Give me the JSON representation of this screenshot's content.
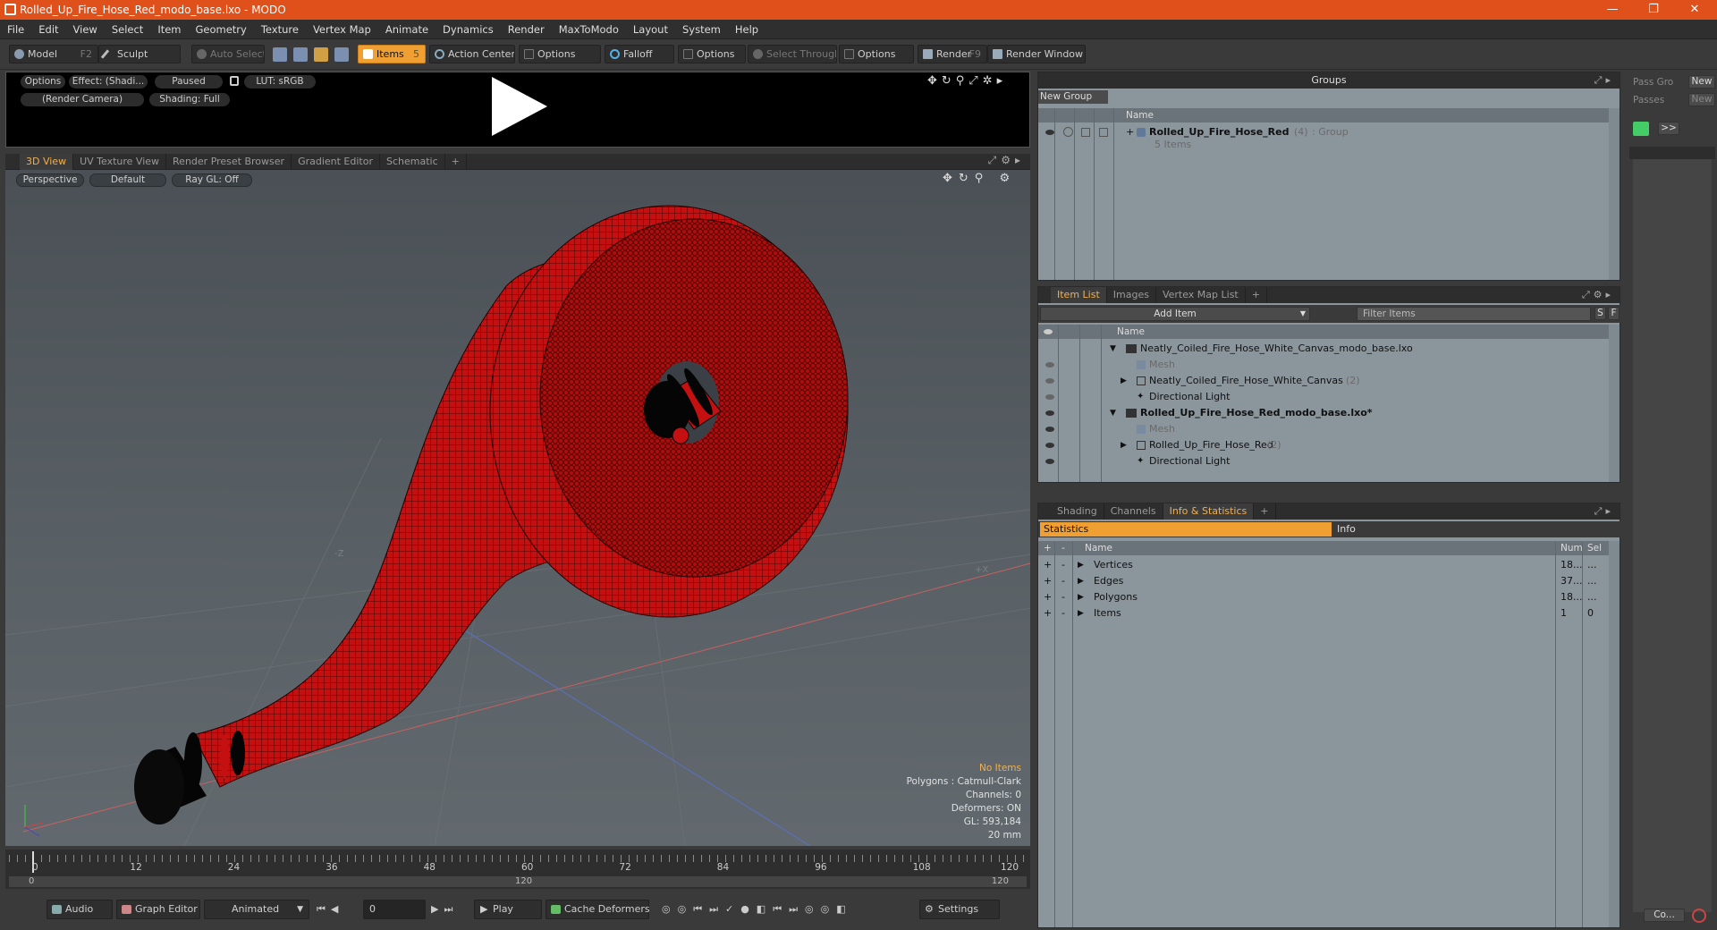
{
  "window": {
    "title": "Rolled_Up_Fire_Hose_Red_modo_base.lxo - MODO",
    "minimize": "—",
    "maximize": "❐",
    "close": "✕"
  },
  "menu": [
    "File",
    "Edit",
    "View",
    "Select",
    "Item",
    "Geometry",
    "Texture",
    "Vertex Map",
    "Animate",
    "Dynamics",
    "Render",
    "MaxToModo",
    "Layout",
    "System",
    "Help"
  ],
  "toolbar": {
    "model": "Model",
    "model_key": "F2",
    "sculpt": "Sculpt",
    "auto_select": "Auto Select",
    "items": "Items",
    "items_key": "5",
    "action_center": "Action Center",
    "options1": "Options",
    "falloff": "Falloff",
    "options2": "Options",
    "select_through": "Select Through",
    "options3": "Options",
    "render": "Render",
    "render_key": "F9",
    "render_window": "Render Window"
  },
  "preview": {
    "options": "Options",
    "effect": "Effect: (Shadi...",
    "paused": "Paused",
    "lut": "LUT: sRGB",
    "camera": "(Render Camera)",
    "shading": "Shading: Full"
  },
  "view_tabs": [
    "3D View",
    "UV Texture View",
    "Render Preset Browser",
    "Gradient Editor",
    "Schematic",
    "+"
  ],
  "viewport": {
    "perspective": "Perspective",
    "default": "Default",
    "raygl": "Ray GL: Off",
    "axis_z": "-Z",
    "axis_x": "+X",
    "hud": {
      "no_items": "No Items",
      "polygons": "Polygons : Catmull-Clark",
      "channels": "Channels: 0",
      "deformers": "Deformers: ON",
      "gl": "GL: 593,184",
      "scale": "20 mm"
    }
  },
  "timeline": {
    "ticks": [
      "0",
      "12",
      "24",
      "36",
      "48",
      "60",
      "72",
      "84",
      "96",
      "108",
      "120"
    ],
    "range_start": "0",
    "range_mid": "120",
    "range_end": "120"
  },
  "bottom": {
    "audio": "Audio",
    "graph_editor": "Graph Editor",
    "animated": "Animated",
    "frame": "0",
    "play": "Play",
    "cache": "Cache Deformers",
    "settings": "Settings"
  },
  "groups": {
    "title": "Groups",
    "new_group": "New Group",
    "col_name": "Name",
    "item_name": "Rolled_Up_Fire_Hose_Red",
    "item_count": "(4)",
    "item_type": ": Group",
    "item_sub": "5 Items"
  },
  "pass": {
    "pass_groups": "Pass Gro",
    "passes": "Passes",
    "new1": "New",
    "new2": "New",
    "more": ">>",
    "co": "Co..."
  },
  "itemlist": {
    "tabs": [
      "Item List",
      "Images",
      "Vertex Map List",
      "+"
    ],
    "add_item": "Add Item",
    "filter": "Filter Items",
    "s": "S",
    "f": "F",
    "col_name": "Name",
    "rows": [
      {
        "label": "Neatly_Coiled_Fire_Hose_White_Canvas_modo_base.lxo",
        "extra": ""
      },
      {
        "label": "Mesh",
        "extra": ""
      },
      {
        "label": "Neatly_Coiled_Fire_Hose_White_Canvas",
        "extra": "(2)"
      },
      {
        "label": "Directional Light",
        "extra": ""
      },
      {
        "label": "Rolled_Up_Fire_Hose_Red_modo_base.lxo*",
        "extra": ""
      },
      {
        "label": "Mesh",
        "extra": ""
      },
      {
        "label": "Rolled_Up_Fire_Hose_Red",
        "extra": "(2)"
      },
      {
        "label": "Directional Light",
        "extra": ""
      }
    ]
  },
  "stats": {
    "tabs": [
      "Shading",
      "Channels",
      "Info & Statistics",
      "+"
    ],
    "statistics": "Statistics",
    "info": "Info",
    "col_plus": "+",
    "col_minus": "-",
    "col_name": "Name",
    "col_num": "Num",
    "col_sel": "Sel",
    "rows": [
      {
        "name": "Vertices",
        "num": "18...",
        "sel": "..."
      },
      {
        "name": "Edges",
        "num": "37...",
        "sel": "..."
      },
      {
        "name": "Polygons",
        "num": "18...",
        "sel": "..."
      },
      {
        "name": "Items",
        "num": "1",
        "sel": "0"
      }
    ]
  },
  "colors": {
    "accent": "#f0a033",
    "title": "#e0501a",
    "hose": "#c41010"
  }
}
